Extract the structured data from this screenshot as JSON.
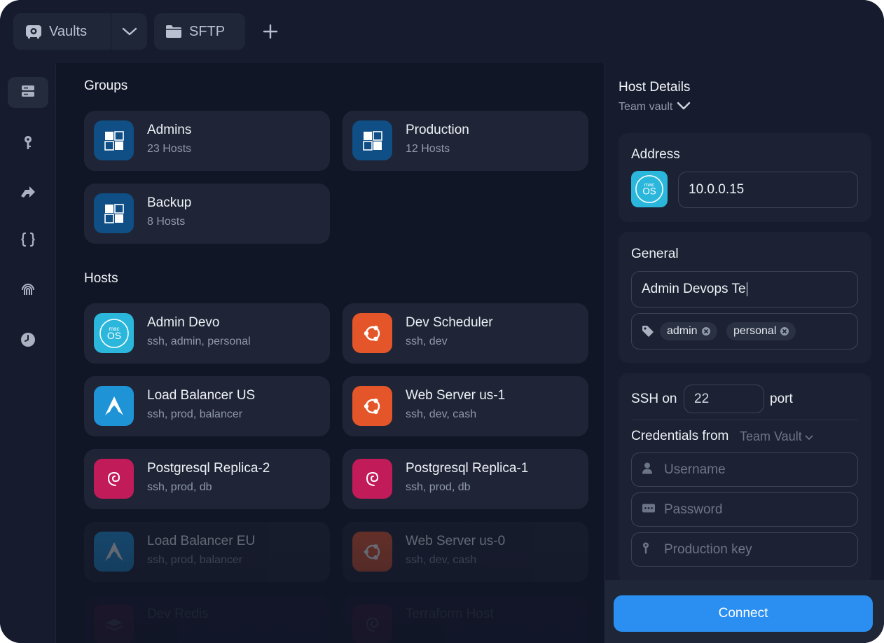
{
  "tabs": {
    "vaults_label": "Vaults",
    "sftp_label": "SFTP"
  },
  "sidebar": {
    "items": [
      {
        "icon": "hosts-icon",
        "active": true
      },
      {
        "icon": "key-icon"
      },
      {
        "icon": "port-forwarding-icon"
      },
      {
        "icon": "snippets-icon"
      },
      {
        "icon": "fingerprint-icon"
      },
      {
        "icon": "history-icon"
      }
    ]
  },
  "groups": {
    "title": "Groups",
    "items": [
      {
        "name": "Admins",
        "count": "23 Hosts"
      },
      {
        "name": "Production",
        "count": "12 Hosts"
      },
      {
        "name": "Backup",
        "count": "8 Hosts"
      }
    ]
  },
  "hosts": {
    "title": "Hosts",
    "items": [
      {
        "name": "Admin Devo",
        "tags": "ssh, admin, personal",
        "os": "macos",
        "os_badge": "OS",
        "os_badge_small": "mac"
      },
      {
        "name": "Dev Scheduler",
        "tags": "ssh, dev",
        "os": "ubuntu"
      },
      {
        "name": "Load Balancer US",
        "tags": "ssh, prod, balancer",
        "os": "arch"
      },
      {
        "name": "Web Server us-1",
        "tags": "ssh, dev, cash",
        "os": "ubuntu"
      },
      {
        "name": "Postgresql Replica-2",
        "tags": "ssh, prod, db",
        "os": "debian"
      },
      {
        "name": "Postgresql Replica-1",
        "tags": "ssh, prod, db",
        "os": "debian"
      },
      {
        "name": "Load Balancer EU",
        "tags": "ssh, prod, balancer",
        "os": "arch"
      },
      {
        "name": "Web Server us-0",
        "tags": "ssh, dev, cash",
        "os": "ubuntu"
      },
      {
        "name": "Dev Redis",
        "tags": "",
        "os": "redis"
      },
      {
        "name": "Terraform Host",
        "tags": "",
        "os": "debian"
      }
    ]
  },
  "details": {
    "title": "Host Details",
    "vault": "Team vault",
    "address_label": "Address",
    "address_value": "10.0.0.15",
    "general_label": "General",
    "label_value": "Admin Devops Te",
    "tags": [
      "admin",
      "personal"
    ],
    "ssh_on": "SSH on",
    "port_value": "22",
    "port_label": "port",
    "credentials_label": "Credentials from",
    "credentials_source": "Team Vault",
    "username_placeholder": "Username",
    "password_placeholder": "Password",
    "key_placeholder": "Production key",
    "connect_label": "Connect"
  },
  "colors": {
    "accent": "#2a8ff0",
    "background": "#141a2b",
    "card": "#1f2536",
    "ubuntu": "#e4562a",
    "debian": "#c21b5a",
    "arch": "#1e93d6",
    "macos": "#2bb7dc",
    "group": "#0f4f86"
  }
}
